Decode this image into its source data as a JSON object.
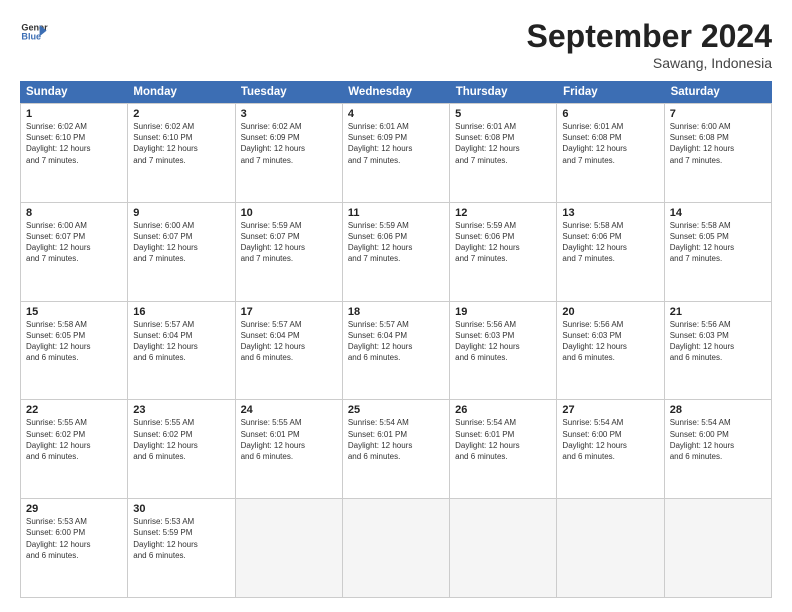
{
  "header": {
    "logo_line1": "General",
    "logo_line2": "Blue",
    "month_title": "September 2024",
    "subtitle": "Sawang, Indonesia"
  },
  "weekdays": [
    "Sunday",
    "Monday",
    "Tuesday",
    "Wednesday",
    "Thursday",
    "Friday",
    "Saturday"
  ],
  "weeks": [
    [
      {
        "day": "1",
        "info": "Sunrise: 6:02 AM\nSunset: 6:10 PM\nDaylight: 12 hours\nand 7 minutes."
      },
      {
        "day": "2",
        "info": "Sunrise: 6:02 AM\nSunset: 6:10 PM\nDaylight: 12 hours\nand 7 minutes."
      },
      {
        "day": "3",
        "info": "Sunrise: 6:02 AM\nSunset: 6:09 PM\nDaylight: 12 hours\nand 7 minutes."
      },
      {
        "day": "4",
        "info": "Sunrise: 6:01 AM\nSunset: 6:09 PM\nDaylight: 12 hours\nand 7 minutes."
      },
      {
        "day": "5",
        "info": "Sunrise: 6:01 AM\nSunset: 6:08 PM\nDaylight: 12 hours\nand 7 minutes."
      },
      {
        "day": "6",
        "info": "Sunrise: 6:01 AM\nSunset: 6:08 PM\nDaylight: 12 hours\nand 7 minutes."
      },
      {
        "day": "7",
        "info": "Sunrise: 6:00 AM\nSunset: 6:08 PM\nDaylight: 12 hours\nand 7 minutes."
      }
    ],
    [
      {
        "day": "8",
        "info": "Sunrise: 6:00 AM\nSunset: 6:07 PM\nDaylight: 12 hours\nand 7 minutes."
      },
      {
        "day": "9",
        "info": "Sunrise: 6:00 AM\nSunset: 6:07 PM\nDaylight: 12 hours\nand 7 minutes."
      },
      {
        "day": "10",
        "info": "Sunrise: 5:59 AM\nSunset: 6:07 PM\nDaylight: 12 hours\nand 7 minutes."
      },
      {
        "day": "11",
        "info": "Sunrise: 5:59 AM\nSunset: 6:06 PM\nDaylight: 12 hours\nand 7 minutes."
      },
      {
        "day": "12",
        "info": "Sunrise: 5:59 AM\nSunset: 6:06 PM\nDaylight: 12 hours\nand 7 minutes."
      },
      {
        "day": "13",
        "info": "Sunrise: 5:58 AM\nSunset: 6:06 PM\nDaylight: 12 hours\nand 7 minutes."
      },
      {
        "day": "14",
        "info": "Sunrise: 5:58 AM\nSunset: 6:05 PM\nDaylight: 12 hours\nand 7 minutes."
      }
    ],
    [
      {
        "day": "15",
        "info": "Sunrise: 5:58 AM\nSunset: 6:05 PM\nDaylight: 12 hours\nand 6 minutes."
      },
      {
        "day": "16",
        "info": "Sunrise: 5:57 AM\nSunset: 6:04 PM\nDaylight: 12 hours\nand 6 minutes."
      },
      {
        "day": "17",
        "info": "Sunrise: 5:57 AM\nSunset: 6:04 PM\nDaylight: 12 hours\nand 6 minutes."
      },
      {
        "day": "18",
        "info": "Sunrise: 5:57 AM\nSunset: 6:04 PM\nDaylight: 12 hours\nand 6 minutes."
      },
      {
        "day": "19",
        "info": "Sunrise: 5:56 AM\nSunset: 6:03 PM\nDaylight: 12 hours\nand 6 minutes."
      },
      {
        "day": "20",
        "info": "Sunrise: 5:56 AM\nSunset: 6:03 PM\nDaylight: 12 hours\nand 6 minutes."
      },
      {
        "day": "21",
        "info": "Sunrise: 5:56 AM\nSunset: 6:03 PM\nDaylight: 12 hours\nand 6 minutes."
      }
    ],
    [
      {
        "day": "22",
        "info": "Sunrise: 5:55 AM\nSunset: 6:02 PM\nDaylight: 12 hours\nand 6 minutes."
      },
      {
        "day": "23",
        "info": "Sunrise: 5:55 AM\nSunset: 6:02 PM\nDaylight: 12 hours\nand 6 minutes."
      },
      {
        "day": "24",
        "info": "Sunrise: 5:55 AM\nSunset: 6:01 PM\nDaylight: 12 hours\nand 6 minutes."
      },
      {
        "day": "25",
        "info": "Sunrise: 5:54 AM\nSunset: 6:01 PM\nDaylight: 12 hours\nand 6 minutes."
      },
      {
        "day": "26",
        "info": "Sunrise: 5:54 AM\nSunset: 6:01 PM\nDaylight: 12 hours\nand 6 minutes."
      },
      {
        "day": "27",
        "info": "Sunrise: 5:54 AM\nSunset: 6:00 PM\nDaylight: 12 hours\nand 6 minutes."
      },
      {
        "day": "28",
        "info": "Sunrise: 5:54 AM\nSunset: 6:00 PM\nDaylight: 12 hours\nand 6 minutes."
      }
    ],
    [
      {
        "day": "29",
        "info": "Sunrise: 5:53 AM\nSunset: 6:00 PM\nDaylight: 12 hours\nand 6 minutes."
      },
      {
        "day": "30",
        "info": "Sunrise: 5:53 AM\nSunset: 5:59 PM\nDaylight: 12 hours\nand 6 minutes."
      },
      {
        "day": "",
        "info": ""
      },
      {
        "day": "",
        "info": ""
      },
      {
        "day": "",
        "info": ""
      },
      {
        "day": "",
        "info": ""
      },
      {
        "day": "",
        "info": ""
      }
    ]
  ]
}
